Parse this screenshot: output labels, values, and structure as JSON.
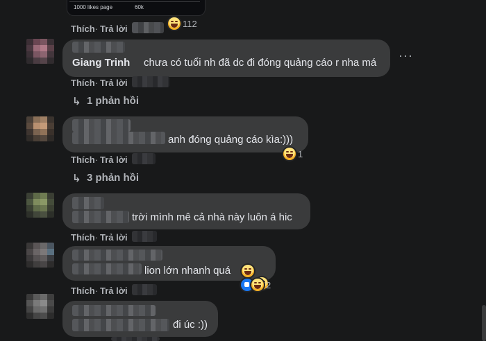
{
  "top_thumbnail": {
    "left_text": "1000 likes page",
    "right_text": "60k"
  },
  "comments": [
    {
      "actions": {
        "like": "Thích",
        "reply": "Trả lời"
      },
      "reaction_count": "112"
    },
    {
      "author": "Giang Trinh",
      "text": "chưa có tuổi nh đã dc đi đóng quảng cáo r nha má",
      "more_label": "···",
      "actions": {
        "like": "Thích",
        "reply": "Trả lời"
      },
      "replies_label": "1 phản hồi"
    },
    {
      "text": "anh đóng quảng cáo kìa:)))",
      "actions": {
        "like": "Thích",
        "reply": "Trả lời"
      },
      "reaction_count": "1",
      "replies_label": "3 phản hồi"
    },
    {
      "text": "trời mình mê cả nhà này luôn á hic",
      "actions": {
        "like": "Thích",
        "reply": "Trả lời"
      }
    },
    {
      "text": "lion lớn nhanh quá",
      "actions": {
        "like": "Thích",
        "reply": "Trả lời"
      },
      "reaction_count": "2"
    },
    {
      "text": "đi úc :))"
    }
  ],
  "reply_arrow": "↳",
  "separator": "·"
}
